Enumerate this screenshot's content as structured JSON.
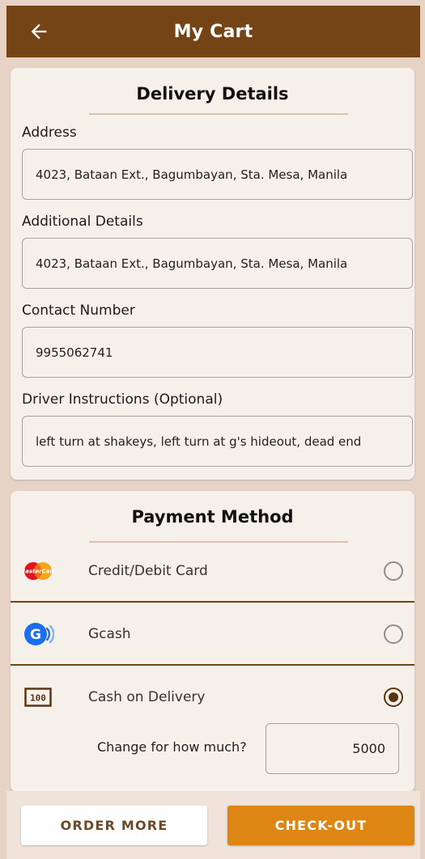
{
  "header": {
    "title": "My Cart",
    "back_icon": "arrow-left-icon"
  },
  "delivery": {
    "title": "Delivery Details",
    "address_label": "Address",
    "address_value": "4023, Bataan Ext., Bagumbayan, Sta. Mesa, Manila",
    "additional_label": "Additional Details",
    "additional_value": "4023, Bataan Ext., Bagumbayan, Sta. Mesa, Manila",
    "contact_label": "Contact Number",
    "contact_value": "9955062741",
    "instructions_label": "Driver Instructions (Optional)",
    "instructions_value": "left turn at shakeys, left turn at g's hideout, dead end"
  },
  "payment": {
    "title": "Payment Method",
    "options": [
      {
        "label": "Credit/Debit Card",
        "icon": "mastercard-icon",
        "selected": false
      },
      {
        "label": "Gcash",
        "icon": "gcash-icon",
        "selected": false
      },
      {
        "label": "Cash on Delivery",
        "icon": "cash-icon",
        "selected": true
      }
    ],
    "mastercard_text": "MasterCard",
    "cash_text": "100",
    "change_label": "Change for how much?",
    "change_value": "5000"
  },
  "actions": {
    "order_more": "ORDER MORE",
    "checkout": "CHECK-OUT"
  },
  "colors": {
    "app_bar": "#744416",
    "background": "#e7d2c6",
    "card": "#f6f0ea",
    "checkout": "#de8613",
    "divider": "#6f4518"
  }
}
